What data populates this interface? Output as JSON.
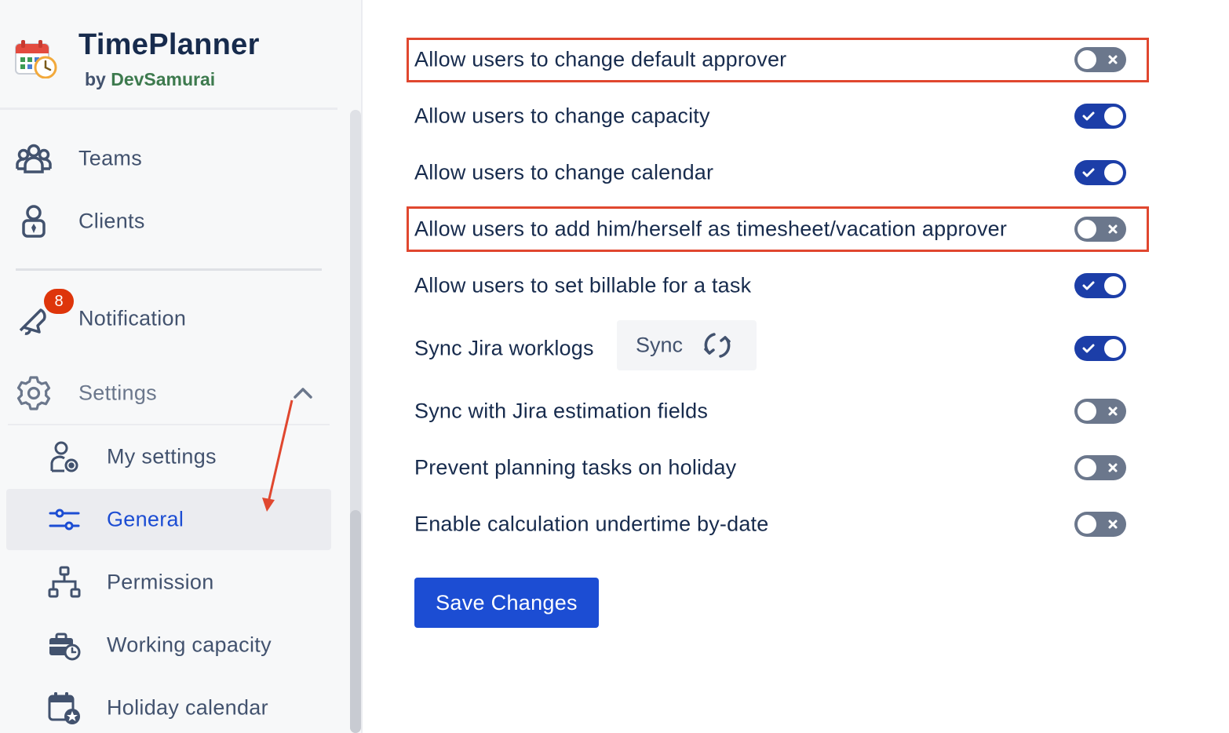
{
  "brand": {
    "title": "TimePlanner",
    "by": "by",
    "company": "DevSamurai"
  },
  "nav": {
    "teams": "Teams",
    "clients": "Clients",
    "notification": "Notification",
    "notification_count": "8",
    "settings": "Settings"
  },
  "settings_menu": [
    {
      "label": "My settings",
      "icon": "user-gear-icon",
      "active": false
    },
    {
      "label": "General",
      "icon": "sliders-icon",
      "active": true
    },
    {
      "label": "Permission",
      "icon": "hierarchy-icon",
      "active": false
    },
    {
      "label": "Working capacity",
      "icon": "briefcase-clock-icon",
      "active": false
    },
    {
      "label": "Holiday calendar",
      "icon": "calendar-star-icon",
      "active": false
    }
  ],
  "options": [
    {
      "label": "Allow users to change default approver",
      "enabled": false,
      "highlighted": true
    },
    {
      "label": "Allow users to change capacity",
      "enabled": true,
      "highlighted": false
    },
    {
      "label": "Allow users to change calendar",
      "enabled": true,
      "highlighted": false
    },
    {
      "label": "Allow users to add him/herself as timesheet/vacation approver",
      "enabled": false,
      "highlighted": true
    },
    {
      "label": "Allow users to set billable for a task",
      "enabled": true,
      "highlighted": false
    },
    {
      "label": "Sync Jira worklogs",
      "enabled": true,
      "highlighted": false
    },
    {
      "label": "Sync with Jira estimation fields",
      "enabled": false,
      "highlighted": false
    },
    {
      "label": "Prevent planning tasks on holiday",
      "enabled": false,
      "highlighted": false
    },
    {
      "label": "Enable calculation undertime by-date",
      "enabled": false,
      "highlighted": false
    }
  ],
  "sync_button": {
    "label": "Sync",
    "icon": "refresh-icon"
  },
  "save_button": {
    "label": "Save Changes"
  },
  "colors": {
    "accent": "#1c4dd3",
    "toggle_on": "#1c3ea8",
    "toggle_off": "#6b778c",
    "highlight": "#e0472f",
    "badge": "#de350b"
  }
}
